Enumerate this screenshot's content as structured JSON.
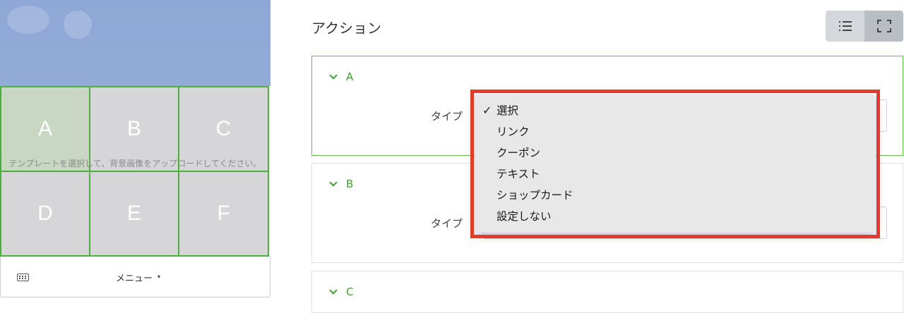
{
  "preview": {
    "cells": [
      {
        "letter": "A",
        "selected": true
      },
      {
        "letter": "B",
        "selected": false
      },
      {
        "letter": "C",
        "selected": false
      },
      {
        "letter": "D",
        "selected": false
      },
      {
        "letter": "E",
        "selected": false
      },
      {
        "letter": "F",
        "selected": false
      }
    ],
    "hint": "テンプレートを選択して、背景画像をアップロードしてください。",
    "menu_label": "メニュー",
    "menu_caret": "▾",
    "keyboard_icon": "keyboard-icon",
    "accent_color": "#4caf3f"
  },
  "actions": {
    "title": "アクション",
    "view_toggle": [
      "list-icon",
      "expand-icon"
    ],
    "cards": [
      {
        "letter": "A",
        "type_label": "タイプ"
      },
      {
        "letter": "B",
        "type_label": "タイプ"
      },
      {
        "letter": "C",
        "type_label": ""
      }
    ]
  },
  "dropdown": {
    "selected_mark": "✓",
    "options": [
      "選択",
      "リンク",
      "クーポン",
      "テキスト",
      "ショップカード",
      "設定しない"
    ],
    "selected_index": 0,
    "highlight_color": "#e23c2a"
  }
}
